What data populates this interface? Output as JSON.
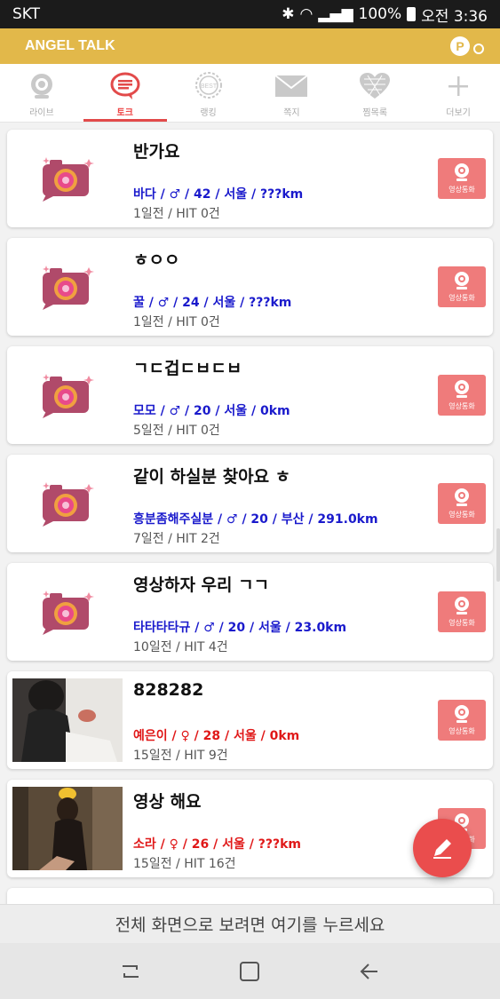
{
  "status_bar": {
    "carrier": "SKT",
    "battery": "100%",
    "time": "오전 3:36"
  },
  "app_bar": {
    "title": "ANGEL TALK",
    "point_label": "P"
  },
  "tabs": [
    {
      "label": "라이브",
      "icon": "webcam-icon"
    },
    {
      "label": "토크",
      "icon": "chat-bubble-icon",
      "active": true
    },
    {
      "label": "랭킹",
      "icon": "best-medal-icon"
    },
    {
      "label": "쪽지",
      "icon": "envelope-icon"
    },
    {
      "label": "찜목록",
      "icon": "heart-icon"
    },
    {
      "label": "더보기",
      "icon": "plus-icon"
    }
  ],
  "posts": [
    {
      "title": "반가요",
      "meta": "바다 / ♂ / 42 / 서울 / ???km",
      "sub": "1일전 / HIT 0건",
      "gender": "male",
      "thumb": "camera-icon"
    },
    {
      "title": "ㅎㅇㅇ",
      "meta": "꿀 / ♂ / 24 / 서울 / ???km",
      "sub": "1일전 / HIT 0건",
      "gender": "male",
      "thumb": "camera-icon"
    },
    {
      "title": "ㄱㄷ겁ㄷㅂㄷㅂ",
      "meta": "모모 / ♂ / 20 / 서울 / 0km",
      "sub": "5일전 / HIT 0건",
      "gender": "male",
      "thumb": "camera-icon"
    },
    {
      "title": "같이 하실분 찾아요 ㅎ",
      "meta": "흥분좀해주실분 / ♂ / 20 / 부산 / 291.0km",
      "sub": "7일전 / HIT 2건",
      "gender": "male",
      "thumb": "camera-icon"
    },
    {
      "title": "영상하자 우리 ㄱㄱ",
      "meta": "타타타타규 / ♂ / 20 / 서울 / 23.0km",
      "sub": "10일전 / HIT 4건",
      "gender": "male",
      "thumb": "camera-icon"
    },
    {
      "title": "828282",
      "meta": "예은이 / ♀ / 28 / 서울 / 0km",
      "sub": "15일전 / HIT 9건",
      "gender": "female",
      "thumb": "photo"
    },
    {
      "title": "영상 해요",
      "meta": "소라 / ♀ / 26 / 서울 / ???km",
      "sub": "15일전 / HIT 16건",
      "gender": "female",
      "thumb": "photo"
    }
  ],
  "video_call_label": "영상통화",
  "fullscreen_prompt": "전체 화면으로 보려면 여기를 누르세요",
  "colors": {
    "accent": "#e2b84a",
    "active_tab": "#e24a4a",
    "male_text": "#1a1acc",
    "female_text": "#e01818",
    "video_call_bg": "#ef7b7b",
    "fab": "#ea4d4d"
  }
}
